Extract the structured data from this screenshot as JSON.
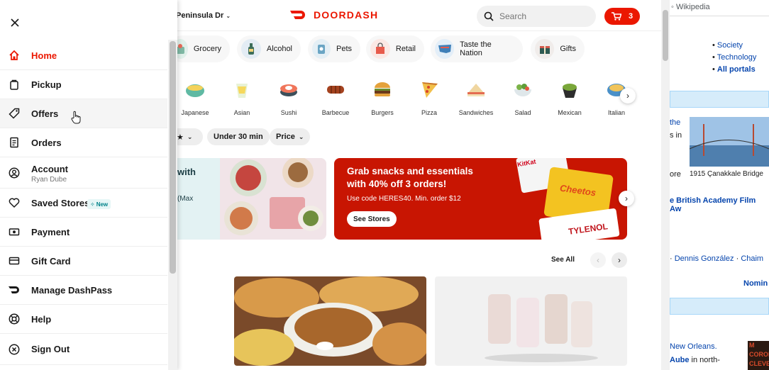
{
  "header": {
    "address": "Peninsula Dr",
    "logo_text": "DOORDASH",
    "search_placeholder": "Search",
    "cart_count": "3",
    "brand_color": "#eb1700"
  },
  "verticals": [
    "Grocery",
    "Alcohol",
    "Pets",
    "Retail",
    "Taste the Nation",
    "Gifts"
  ],
  "cuisines": [
    "Japanese",
    "Asian",
    "Sushi",
    "Barbecue",
    "Burgers",
    "Pizza",
    "Sandwiches",
    "Salad",
    "Mexican",
    "Italian"
  ],
  "filters": {
    "rating_chip": "★",
    "under30": "Under 30 min",
    "price": "Price"
  },
  "promo_left": {
    "line1": "with",
    "line2": "(Max"
  },
  "promo_red": {
    "headline1": "Grab snacks and essentials",
    "headline2": "with 40% off 3 orders!",
    "code_text": "Use code HERES40. Min. order $12",
    "button": "See Stores",
    "products": [
      "KitKat",
      "Cheetos",
      "TYLENOL"
    ]
  },
  "section": {
    "see_all": "See All"
  },
  "drawer": {
    "menu": [
      {
        "label": "Home",
        "icon": "home-icon",
        "active": true
      },
      {
        "label": "Pickup",
        "icon": "pickup-bag-icon"
      },
      {
        "label": "Offers",
        "icon": "tag-icon"
      },
      {
        "label": "Orders",
        "icon": "receipt-icon"
      },
      {
        "label": "Account",
        "icon": "user-circle-icon",
        "sub": "Ryan Dube"
      },
      {
        "label": "Saved Stores",
        "icon": "heart-icon",
        "badge": "New"
      },
      {
        "label": "Payment",
        "icon": "cash-icon"
      },
      {
        "label": "Gift Card",
        "icon": "credit-card-icon"
      },
      {
        "label": "Manage DashPass",
        "icon": "dashpass-icon"
      },
      {
        "label": "Help",
        "icon": "lifebuoy-icon"
      },
      {
        "label": "Sign Out",
        "icon": "sign-out-icon"
      }
    ]
  },
  "wiki": {
    "top_link": "Wikipedia",
    "portals": [
      "Society",
      "Technology",
      "All portals"
    ],
    "snippet_the": "the",
    "snippet_sin": "s in",
    "snippet_ore": "ore",
    "image_caption": "1915 Çanakkale Bridge",
    "bafta_link": "e British Academy Film Aw",
    "people_sep1": "·",
    "person1": "Dennis González",
    "people_sep2": "·",
    "person2": "Chaim",
    "nomin": "Nomin",
    "new_orleans": "New Orleans.",
    "aube": "Aube",
    "in_north": " in north-",
    "poster_lines": [
      "M",
      "CORON",
      "CLEVE"
    ]
  }
}
